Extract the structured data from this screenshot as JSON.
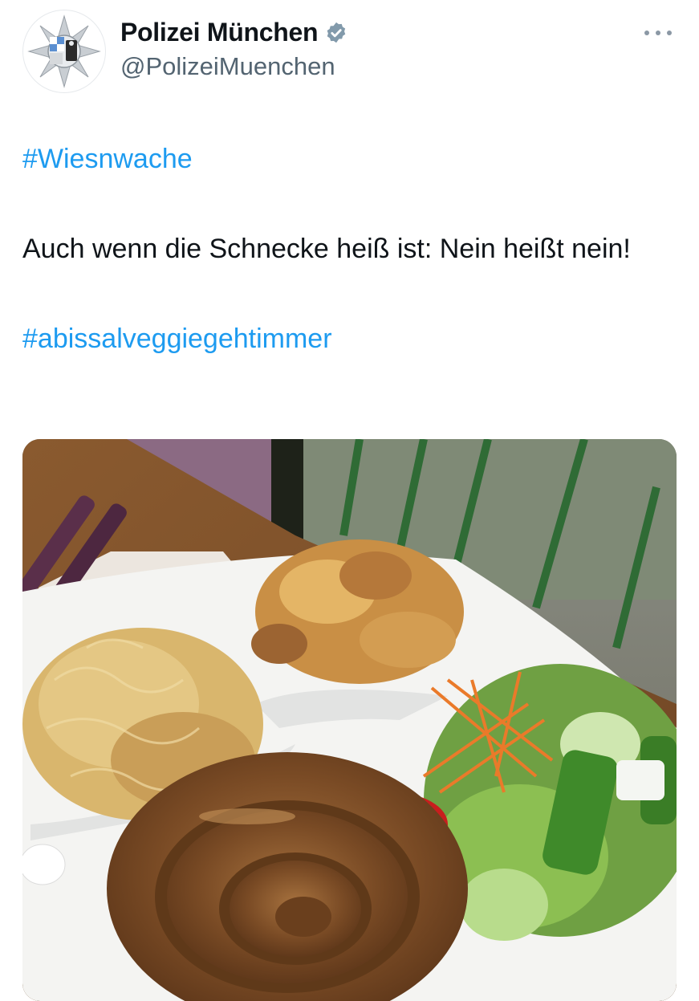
{
  "author": {
    "display_name": "Polizei München",
    "handle": "@PolizeiMuenchen",
    "verified": true,
    "avatar_icon": "police-star-icon"
  },
  "menu": {
    "icon": "more-horizontal-icon"
  },
  "tweet": {
    "hashtag_1": "#Wiesnwache",
    "body": "Auch wenn die Schnecke heiß ist: Nein heißt nein!",
    "hashtag_2": "#abissalveggiegehtimmer"
  },
  "media": {
    "image_icon": "food-photo-image"
  },
  "colors": {
    "link": "#1d9bf0",
    "verified": "#829aab",
    "secondary_text": "#536471"
  }
}
